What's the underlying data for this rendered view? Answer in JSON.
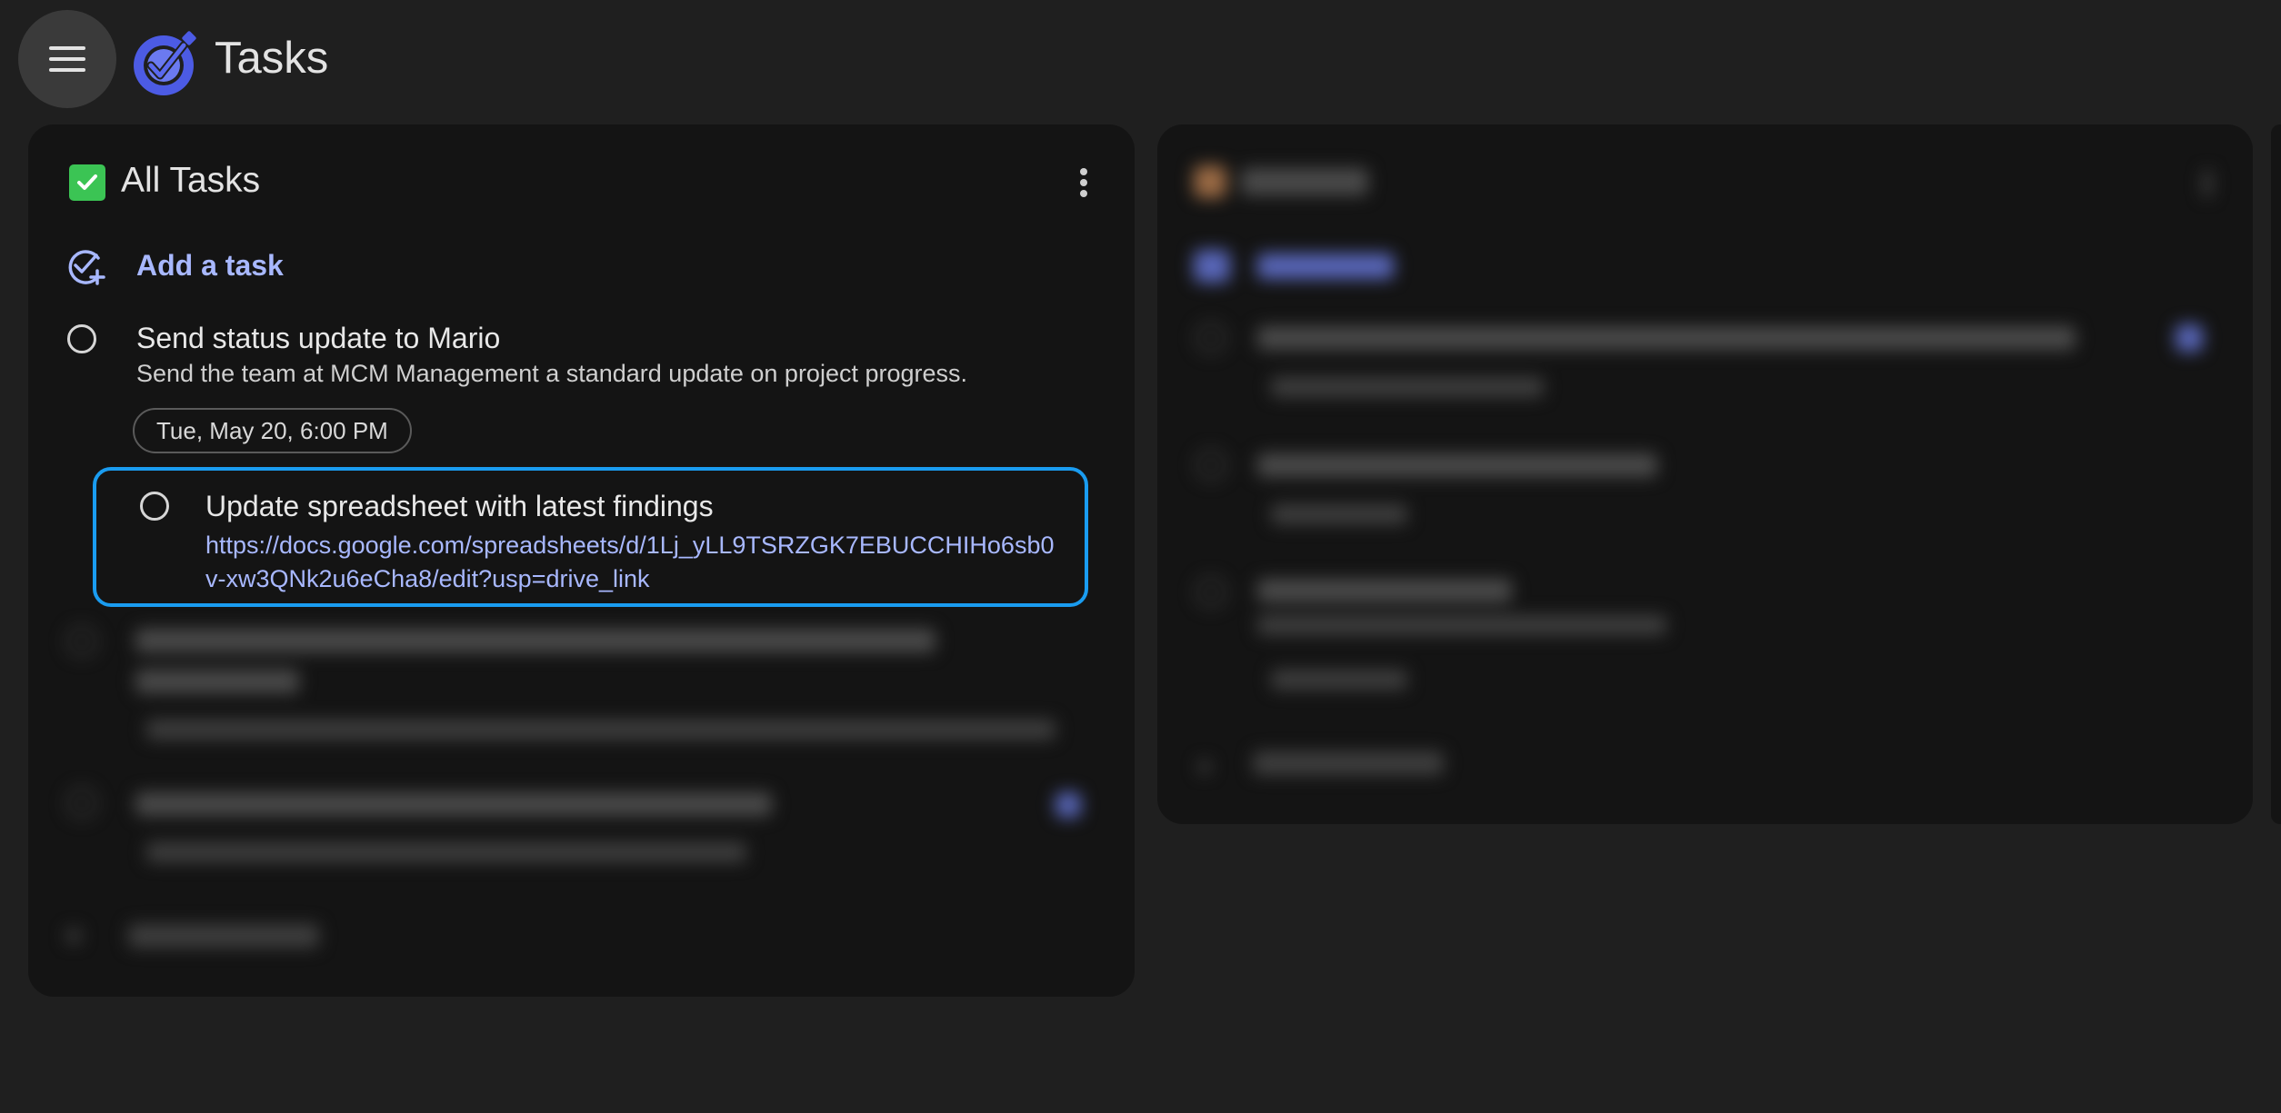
{
  "app": {
    "title": "Tasks",
    "menu_icon": "hamburger-menu-icon",
    "logo_icon": "tasks-logo-icon"
  },
  "list": {
    "title": "All Tasks",
    "check_color": "#3bc454",
    "add_task_label": "Add a task"
  },
  "tasks": [
    {
      "title": "Send status update to Mario",
      "description": "Send the team at MCM Management a standard update on project progress.",
      "date": "Tue, May 20, 6:00 PM"
    },
    {
      "title": "Update spreadsheet with latest findings",
      "link": "https://docs.google.com/spreadsheets/d/1Lj_yLL9TSRZGK7EBUCCHIHo6sb0v-xw3QNk2u6eCha8/edit?usp=drive_link"
    }
  ],
  "colors": {
    "focus_border": "#1a9cf0",
    "accent_link": "#a8b8ff",
    "background": "#1f1f1f",
    "card": "#141414"
  }
}
